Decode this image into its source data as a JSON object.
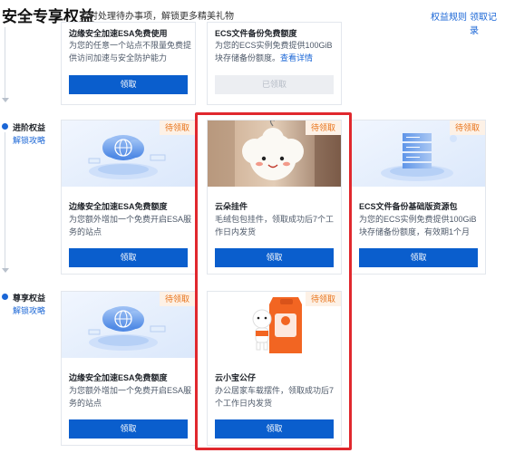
{
  "header": {
    "title": "安全专享权益",
    "subtitle": "及时处理待办事项，解锁更多精美礼物",
    "link_rules": "权益规则",
    "link_records": "领取记录"
  },
  "tiers": {
    "advanced": {
      "label": "进阶权益",
      "link": "解锁攻略"
    },
    "premium": {
      "label": "尊享权益",
      "link": "解锁攻略"
    }
  },
  "cards": {
    "basic_esa": {
      "title": "边缘安全加速ESA免费使用",
      "desc": "为您的任意一个站点不限量免费提供访问加速与安全防护能力",
      "button": "领取"
    },
    "basic_ecs": {
      "title": "ECS文件备份免费额度",
      "desc": "为您的ECS实例免费提供100GiB块存储备份额度。",
      "desc_link": "查看详情",
      "button": "已领取"
    },
    "adv_esa": {
      "badge": "待领取",
      "title": "边缘安全加速ESA免费额度",
      "desc": "为您额外增加一个免费开启ESA服务的站点",
      "button": "领取"
    },
    "adv_cloud": {
      "badge": "待领取",
      "title": "云朵挂件",
      "desc": "毛绒包包挂件，领取成功后7个工作日内发货",
      "button": "领取"
    },
    "adv_ecs": {
      "badge": "待领取",
      "title": "ECS文件备份基础版资源包",
      "desc": "为您的ECS实例免费提供100GiB块存储备份额度，有效期1个月",
      "button": "领取"
    },
    "prem_esa": {
      "badge": "待领取",
      "title": "边缘安全加速ESA免费额度",
      "desc": "为您额外增加一个免费开启ESA服务的站点",
      "button": "领取"
    },
    "prem_doll": {
      "badge": "待领取",
      "title": "云小宝公仔",
      "desc": "办公居家车载摆件，领取成功后7个工作日内发货",
      "button": "领取"
    }
  },
  "colors": {
    "accent": "#0a5ecd",
    "link": "#1a66d6",
    "badge_text": "#e8731a",
    "badge_bg": "#fdf1e6",
    "highlight": "#e0282e"
  }
}
